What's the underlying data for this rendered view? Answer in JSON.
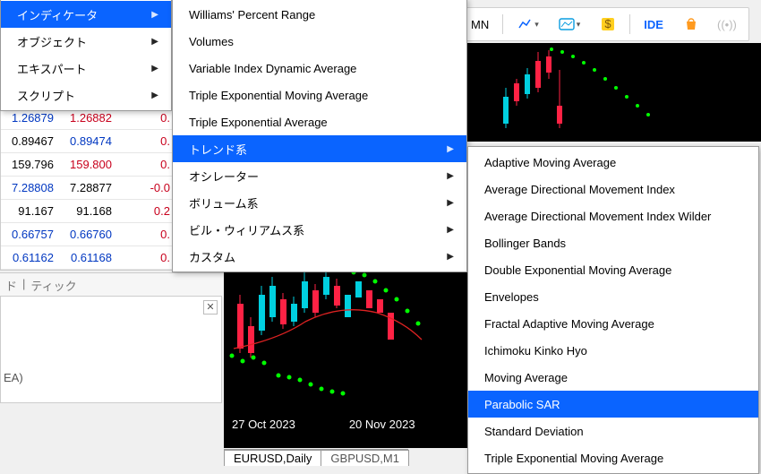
{
  "toolbar": {
    "mn_label": "MN",
    "ide_label": "IDE"
  },
  "menu1": {
    "items": [
      {
        "label": "インディケータ",
        "arrow": true,
        "highlight": true
      },
      {
        "label": "オブジェクト",
        "arrow": true
      },
      {
        "label": "エキスパート",
        "arrow": true
      },
      {
        "label": "スクリプト",
        "arrow": true
      }
    ]
  },
  "menu2": {
    "items": [
      {
        "label": "Williams' Percent Range"
      },
      {
        "label": "Volumes"
      },
      {
        "label": "Variable Index Dynamic Average"
      },
      {
        "label": "Triple Exponential Moving Average"
      },
      {
        "label": "Triple Exponential Average"
      },
      {
        "label": "トレンド系",
        "arrow": true,
        "highlight": true
      },
      {
        "label": "オシレーター",
        "arrow": true
      },
      {
        "label": "ボリューム系",
        "arrow": true
      },
      {
        "label": "ビル・ウィリアムス系",
        "arrow": true
      },
      {
        "label": "カスタム",
        "arrow": true
      }
    ]
  },
  "menu3": {
    "items": [
      {
        "label": "Adaptive Moving Average"
      },
      {
        "label": "Average Directional Movement Index"
      },
      {
        "label": "Average Directional Movement Index Wilder"
      },
      {
        "label": "Bollinger Bands"
      },
      {
        "label": "Double Exponential Moving Average"
      },
      {
        "label": "Envelopes"
      },
      {
        "label": "Fractal Adaptive Moving Average"
      },
      {
        "label": "Ichimoku Kinko Hyo"
      },
      {
        "label": "Moving Average"
      },
      {
        "label": "Parabolic SAR",
        "highlight": true
      },
      {
        "label": "Standard Deviation"
      },
      {
        "label": "Triple Exponential Moving Average"
      }
    ]
  },
  "grid": {
    "rows": [
      {
        "c1": "1.26879",
        "c1c": "blue",
        "c2": "1.26882",
        "c2c": "red",
        "c3": "0."
      },
      {
        "c1": "0.89467",
        "c1c": "black",
        "c2": "0.89474",
        "c2c": "blue",
        "c3": "0."
      },
      {
        "c1": "159.796",
        "c1c": "black",
        "c2": "159.800",
        "c2c": "red",
        "c3": "0."
      },
      {
        "c1": "7.28808",
        "c1c": "blue",
        "c2": "7.28877",
        "c2c": "black",
        "c3": "-0.0"
      },
      {
        "c1": "91.167",
        "c1c": "black",
        "c2": "91.168",
        "c2c": "black",
        "c3": "0.2"
      },
      {
        "c1": "0.66757",
        "c1c": "blue",
        "c2": "0.66760",
        "c2c": "blue",
        "c3": "0."
      },
      {
        "c1": "0.61162",
        "c1c": "blue",
        "c2": "0.61168",
        "c2c": "blue",
        "c3": "0."
      }
    ]
  },
  "tabs": {
    "a": "ド",
    "b": "ティック"
  },
  "ea_fragment": "EA)",
  "chart": {
    "time1": "27 Oct 2023",
    "time2": "20 Nov 2023",
    "tab_active": "EURUSD,Daily",
    "tab_other": "GBPUSD,M1"
  }
}
